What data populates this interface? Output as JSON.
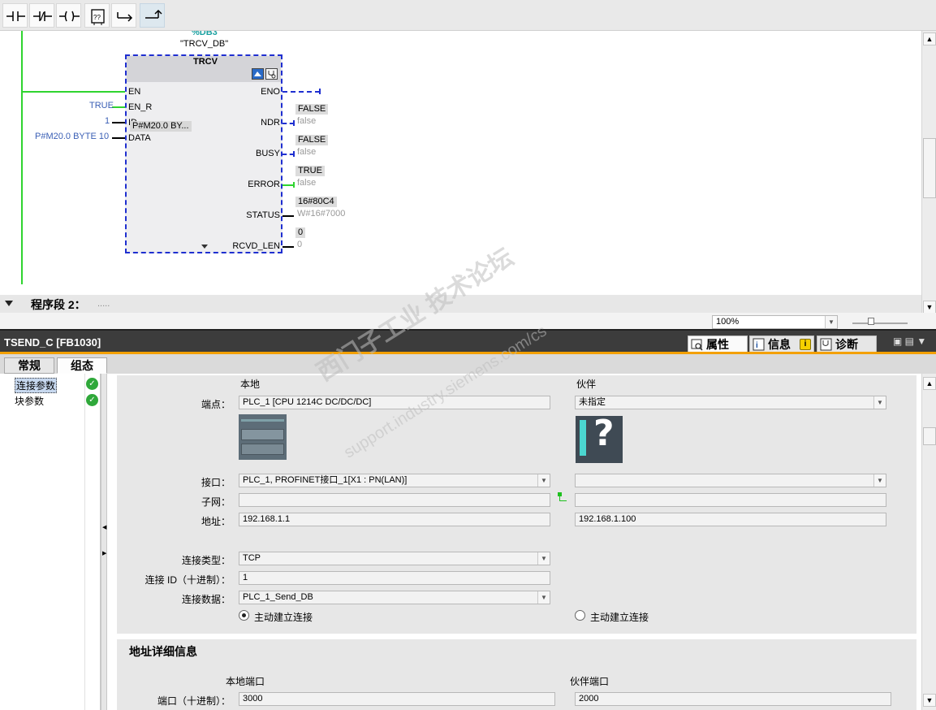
{
  "toolbar": {
    "buttons": [
      {
        "name": "normally-open-contact",
        "glyph": "⊣⊢"
      },
      {
        "name": "normally-closed-contact",
        "glyph": "⊣/⊢"
      },
      {
        "name": "output-coil",
        "glyph": "⊸"
      },
      {
        "name": "empty-box",
        "glyph": "??"
      },
      {
        "name": "open-branch",
        "glyph": "↦"
      },
      {
        "name": "close-branch",
        "glyph": "⬏"
      }
    ]
  },
  "editor": {
    "db_number": "%DB3",
    "db_name": "\"TRCV_DB\"",
    "block_name": "TRCV",
    "inputs": [
      {
        "pin": "EN",
        "value": ""
      },
      {
        "pin": "EN_R",
        "value": "TRUE"
      },
      {
        "pin": "ID",
        "value": "1"
      },
      {
        "pin": "DATA",
        "value": "P#M20.0 BYTE 10"
      }
    ],
    "data_tooltip": "P#M20.0 BY...",
    "outputs": [
      {
        "pin": "ENO",
        "value": "",
        "sub": ""
      },
      {
        "pin": "NDR",
        "value": "FALSE",
        "sub": "false"
      },
      {
        "pin": "BUSY",
        "value": "FALSE",
        "sub": "false"
      },
      {
        "pin": "ERROR",
        "value": "TRUE",
        "sub": "false"
      },
      {
        "pin": "STATUS",
        "value": "16#80C4",
        "sub": "W#16#7000"
      },
      {
        "pin": "RCVD_LEN",
        "value": "0",
        "sub": "0"
      }
    ],
    "segment2_label": "程序段 2：",
    "segment2_comment": ".....",
    "zoom": "100%"
  },
  "inspector": {
    "title": "TSEND_C [FB1030]",
    "right_tabs": [
      {
        "label": "属性",
        "icon": "properties-icon"
      },
      {
        "label": "信息",
        "icon": "info-icon"
      },
      {
        "label": "诊断",
        "icon": "diagnostics-icon"
      }
    ],
    "tabs": [
      "常规",
      "组态"
    ],
    "nav_items": [
      {
        "label": "连接参数",
        "status": "ok"
      },
      {
        "label": "块参数",
        "status": "ok"
      }
    ],
    "connection": {
      "local_header": "本地",
      "partner_header": "伙伴",
      "endpoint_label": "端点：",
      "local_endpoint": "PLC_1 [CPU 1214C DC/DC/DC]",
      "partner_endpoint": "未指定",
      "interface_label": "接口：",
      "local_interface": "PLC_1, PROFINET接口_1[X1 : PN(LAN)]",
      "partner_interface": "",
      "subnet_label": "子网：",
      "local_subnet": "",
      "partner_subnet": "",
      "address_label": "地址：",
      "local_address": "192.168.1.1",
      "partner_address": "192.168.1.100",
      "conn_type_label": "连接类型：",
      "conn_type": "TCP",
      "conn_id_label": "连接 ID（十进制）：",
      "conn_id": "1",
      "conn_data_label": "连接数据：",
      "conn_data": "PLC_1_Send_DB",
      "local_active_label": "主动建立连接",
      "partner_active_label": "主动建立连接",
      "local_active": true,
      "partner_active": false
    },
    "address_details": {
      "title": "地址详细信息",
      "local_port_header": "本地端口",
      "partner_port_header": "伙伴端口",
      "port_label": "端口（十进制）：",
      "local_port": "3000",
      "partner_port": "2000"
    }
  },
  "watermark": {
    "line1": "西门子工业 技术论坛",
    "line2": "support.industry.siemens.com/cs"
  }
}
